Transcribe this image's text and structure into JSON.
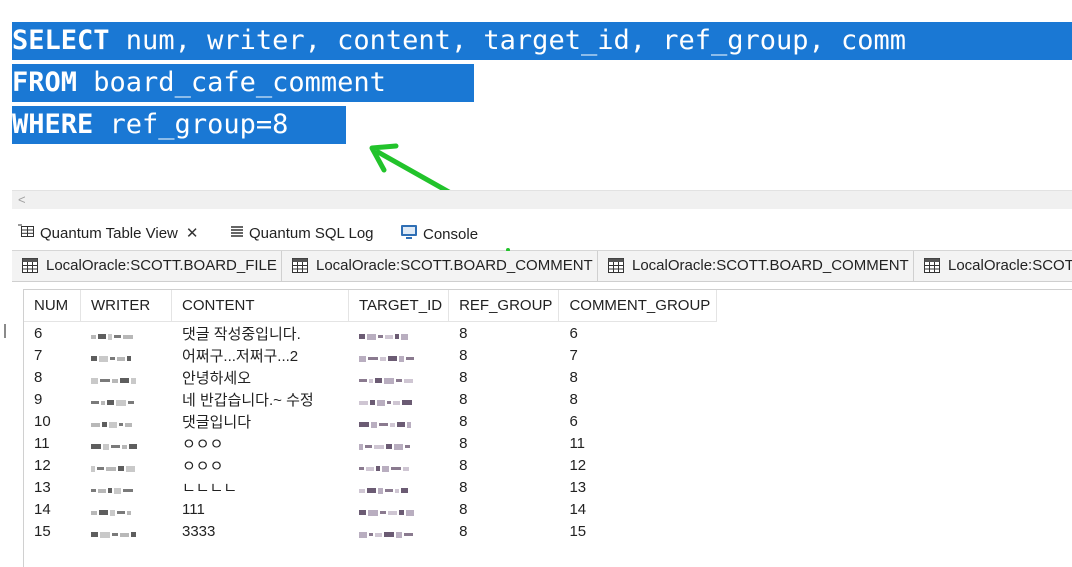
{
  "sql": {
    "line1": {
      "kw": "SELECT",
      "rest": " num, writer, content, target_id, ref_group, comm"
    },
    "line2": {
      "kw": "FROM",
      "rest": " board_cafe_comment"
    },
    "line3": {
      "kw": "WHERE",
      "rest": " ref_group=8"
    }
  },
  "scroll_left_glyph": "<",
  "view_tabs": [
    {
      "label": "Quantum Table View",
      "icon": "table-view-icon",
      "close": "✕"
    },
    {
      "label": "Quantum SQL Log",
      "icon": "sql-log-icon"
    },
    {
      "label": "Console",
      "icon": "console-icon"
    }
  ],
  "connection_tabs": [
    "LocalOracle:SCOTT.BOARD_FILE",
    "LocalOracle:SCOTT.BOARD_COMMENT",
    "LocalOracle:SCOTT.BOARD_COMMENT",
    "LocalOracle:SCOTT"
  ],
  "table": {
    "columns": [
      "NUM",
      "WRITER",
      "CONTENT",
      "TARGET_ID",
      "REF_GROUP",
      "COMMENT_GROUP"
    ],
    "rows": [
      {
        "num": "6",
        "content": "댓글 작성중입니다.",
        "ref_group": "8",
        "comment_group": "6"
      },
      {
        "num": "7",
        "content": "어쩌구...저쩌구...2",
        "ref_group": "8",
        "comment_group": "7"
      },
      {
        "num": "8",
        "content": "안녕하세오",
        "ref_group": "8",
        "comment_group": "8"
      },
      {
        "num": "9",
        "content": "네 반갑습니다.~ 수정",
        "ref_group": "8",
        "comment_group": "8"
      },
      {
        "num": "10",
        "content": "댓글입니다",
        "ref_group": "8",
        "comment_group": "6"
      },
      {
        "num": "11",
        "content": "ㅇㅇㅇ",
        "ref_group": "8",
        "comment_group": "11"
      },
      {
        "num": "12",
        "content": "ㅇㅇㅇ",
        "ref_group": "8",
        "comment_group": "12"
      },
      {
        "num": "13",
        "content": "ㄴㄴㄴㄴ",
        "ref_group": "8",
        "comment_group": "13"
      },
      {
        "num": "14",
        "content": "111",
        "ref_group": "8",
        "comment_group": "14"
      },
      {
        "num": "15",
        "content": "3333",
        "ref_group": "8",
        "comment_group": "15"
      }
    ]
  },
  "colors": {
    "selection": "#1a78d4",
    "arrow": "#22c32b"
  }
}
